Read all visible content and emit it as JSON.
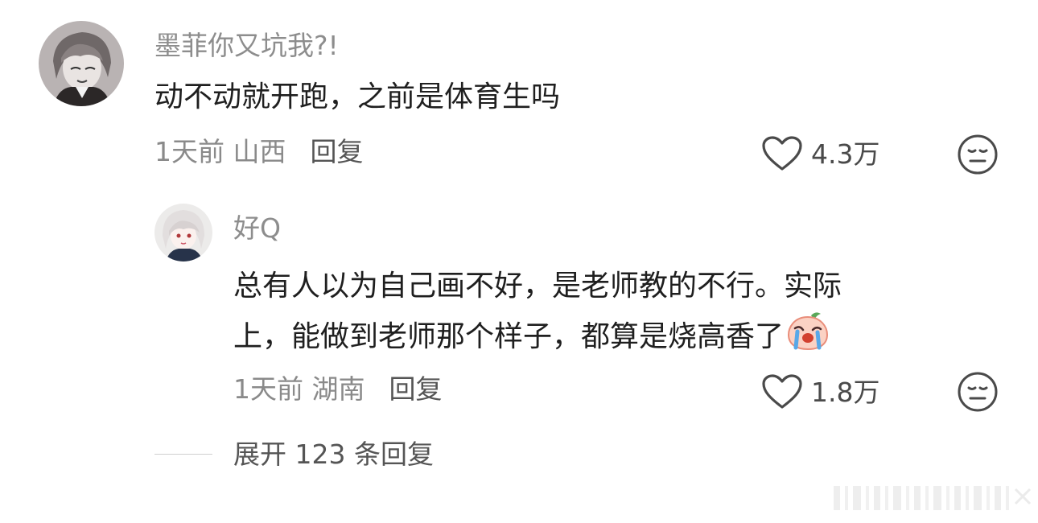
{
  "comment": {
    "username": "墨菲你又坑我?!",
    "content": "动不动就开跑，之前是体育生吗",
    "time_location": "1天前 山西",
    "reply_label": "回复",
    "like_count": "4.3万"
  },
  "reply": {
    "username": "好Q",
    "content_line1": "总有人以为自己画不好，是老师教的不行。实际",
    "content_line2": "上，能做到老师那个样子，都算是烧高香了",
    "time_location": "1天前 湖南",
    "reply_label": "回复",
    "like_count": "1.8万"
  },
  "expand_label": "展开 123 条回复",
  "icons": {
    "like": "heart-outline-icon",
    "dislike": "meh-face-icon",
    "inline_emoji": "crying-peach-emoji"
  }
}
